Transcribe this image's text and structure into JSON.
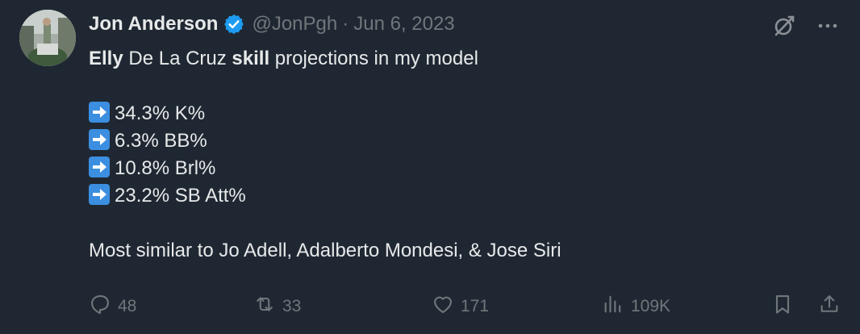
{
  "author": {
    "name": "Jon Anderson",
    "handle": "@JonPgh",
    "separator": "·",
    "date": "Jun 6, 2023",
    "verified": true
  },
  "tweet": {
    "line1": {
      "part1": "Elly",
      "part2": " De La Cruz ",
      "part3": "skill",
      "part4": " projections in my model"
    },
    "stats": [
      "34.3% K%",
      "6.3% BB%",
      "10.8% Brl%",
      "23.2% SB Att%"
    ],
    "closing": "Most similar to Jo Adell, Adalberto Mondesi, & Jose Siri"
  },
  "actions": {
    "replies": "48",
    "reposts": "33",
    "likes": "171",
    "views": "109K"
  },
  "colors": {
    "background": "#1f2832",
    "text": "#e7e9ea",
    "muted": "#71767b",
    "verified": "#1d9bf0",
    "arrow_emoji": "#3b8ee0"
  },
  "icons": {
    "verified": "verified-badge-icon",
    "grok": "grok-icon",
    "more": "more-icon",
    "reply": "reply-icon",
    "repost": "repost-icon",
    "like": "heart-icon",
    "views": "views-icon",
    "bookmark": "bookmark-icon",
    "share": "share-icon",
    "arrow": "right-arrow-emoji-icon"
  }
}
